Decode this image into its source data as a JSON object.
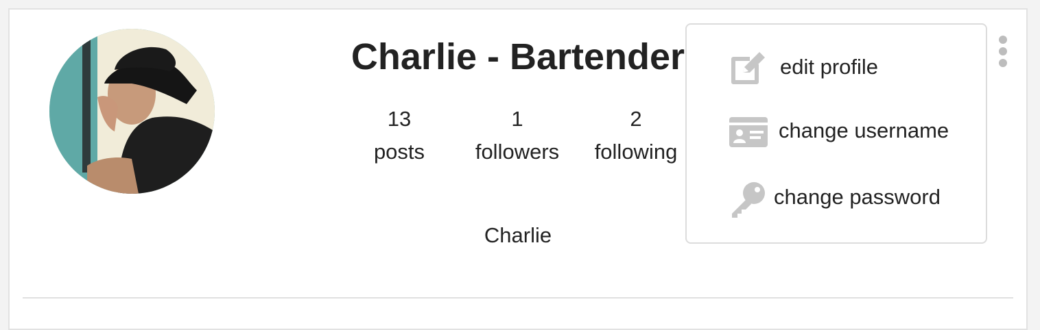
{
  "profile": {
    "name": "Charlie - Bartender",
    "bio": "Charlie"
  },
  "stats": [
    {
      "value": "13",
      "label": "posts"
    },
    {
      "value": "1",
      "label": "followers"
    },
    {
      "value": "2",
      "label": "following"
    }
  ],
  "menu": {
    "items": [
      {
        "label": "edit profile",
        "icon": "edit-icon"
      },
      {
        "label": "change username",
        "icon": "id-card-icon"
      },
      {
        "label": "change password",
        "icon": "key-icon"
      }
    ]
  },
  "colors": {
    "icon_gray": "#c6c6c6",
    "text": "#222222",
    "border": "#dcdcdc"
  }
}
